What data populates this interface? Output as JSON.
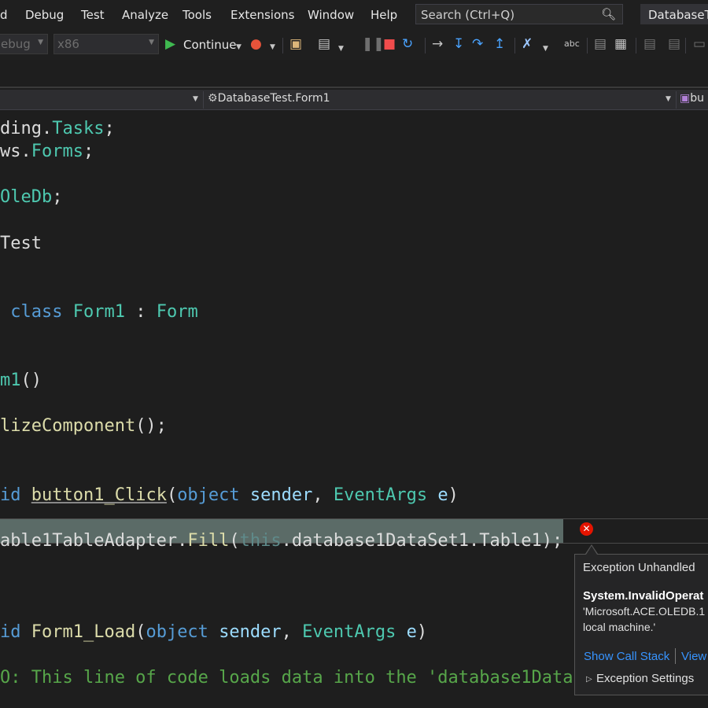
{
  "menu": {
    "items": [
      "d",
      "Debug",
      "Test",
      "Analyze",
      "Tools",
      "Extensions",
      "Window",
      "Help"
    ],
    "search_placeholder": "Search (Ctrl+Q)",
    "solution_name": "DatabaseTest"
  },
  "toolbar": {
    "config": "ebug",
    "platform": "x86",
    "continue_label": "Continue"
  },
  "navbar": {
    "class_label": "DatabaseTest.Form1",
    "member_label": "bu"
  },
  "code_lines": [
    [
      {
        "t": "ding.",
        "c": "plain"
      },
      {
        "t": "Tasks",
        "c": "type"
      },
      {
        "t": ";",
        "c": "plain"
      }
    ],
    [
      {
        "t": "ws.",
        "c": "plain"
      },
      {
        "t": "Forms",
        "c": "type"
      },
      {
        "t": ";",
        "c": "plain"
      }
    ],
    [],
    [
      {
        "t": "OleDb",
        "c": "type"
      },
      {
        "t": ";",
        "c": "plain"
      }
    ],
    [],
    [
      {
        "t": "Test",
        "c": "plain"
      }
    ],
    [],
    [],
    [
      {
        "t": " class ",
        "c": "kw"
      },
      {
        "t": "Form1",
        "c": "type"
      },
      {
        "t": " : ",
        "c": "plain"
      },
      {
        "t": "Form",
        "c": "type"
      }
    ],
    [],
    [],
    [
      {
        "t": "m1",
        "c": "type"
      },
      {
        "t": "()",
        "c": "plain"
      }
    ],
    [],
    [
      {
        "t": "lizeComponent",
        "c": "method"
      },
      {
        "t": "();",
        "c": "plain"
      }
    ],
    [],
    [],
    [
      {
        "t": "id ",
        "c": "kw"
      },
      {
        "t": "button1_Click",
        "c": "method",
        "u": true
      },
      {
        "t": "(",
        "c": "plain"
      },
      {
        "t": "object",
        "c": "kw"
      },
      {
        "t": " ",
        "c": "plain"
      },
      {
        "t": "sender",
        "c": "param"
      },
      {
        "t": ", ",
        "c": "plain"
      },
      {
        "t": "EventArgs",
        "c": "type"
      },
      {
        "t": " ",
        "c": "plain"
      },
      {
        "t": "e",
        "c": "param"
      },
      {
        "t": ")",
        "c": "plain"
      }
    ],
    [],
    [
      {
        "t": "able1TableAdapter.",
        "c": "plain"
      },
      {
        "t": "Fill",
        "c": "method"
      },
      {
        "t": "(",
        "c": "plain"
      },
      {
        "t": "this",
        "c": "dim"
      },
      {
        "t": ".database1DataSet1.Table1);",
        "c": "plain"
      }
    ],
    [],
    [],
    [],
    [
      {
        "t": "id ",
        "c": "kw"
      },
      {
        "t": "Form1_Load",
        "c": "method"
      },
      {
        "t": "(",
        "c": "plain"
      },
      {
        "t": "object",
        "c": "kw"
      },
      {
        "t": " ",
        "c": "plain"
      },
      {
        "t": "sender",
        "c": "param"
      },
      {
        "t": ", ",
        "c": "plain"
      },
      {
        "t": "EventArgs",
        "c": "type"
      },
      {
        "t": " ",
        "c": "plain"
      },
      {
        "t": "e",
        "c": "param"
      },
      {
        "t": ")",
        "c": "plain"
      }
    ],
    [],
    [
      {
        "t": "O: This line of code loads data into the 'database1Data",
        "c": "comment"
      }
    ]
  ],
  "exception_popup": {
    "title": "Exception Unhandled",
    "exception_type": "System.InvalidOperat",
    "message_line1": "'Microsoft.ACE.OLEDB.1",
    "message_line2": "local machine.'",
    "link_call_stack": "Show Call Stack",
    "link_view": "View",
    "settings_label": "Exception Settings"
  },
  "icons": [
    "search-icon",
    "play-icon",
    "fire-icon",
    "folder-icon",
    "window-icon",
    "pause-icon",
    "stop-icon",
    "restart-icon",
    "show-next-statement-icon",
    "step-into-icon",
    "step-over-icon",
    "step-out-icon",
    "error-icon"
  ]
}
